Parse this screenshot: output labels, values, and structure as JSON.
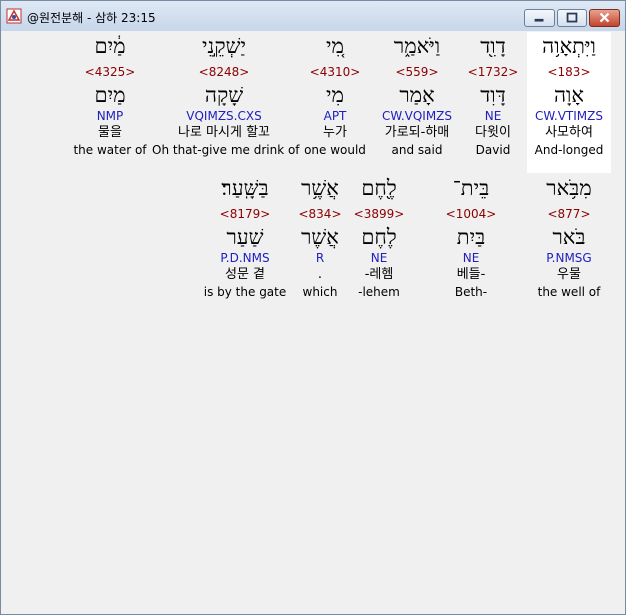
{
  "window": {
    "title": "@원전분해 - 삼하 23:15"
  },
  "rows": [
    {
      "words": [
        {
          "heb": "וַיִּתְאָו֥ה",
          "strong": "<183>",
          "lemma": "אָוָה",
          "parse": "CW.VTIMZS",
          "kor": "사모하여",
          "eng": "And-longed"
        },
        {
          "heb": "דָוִ֖ד",
          "strong": "<1732>",
          "lemma": "דָּוִד",
          "parse": "NE",
          "kor": "다윗이",
          "eng": "David"
        },
        {
          "heb": "וַיֹּאמַ֑ר",
          "strong": "<559>",
          "lemma": "אָמַר",
          "parse": "CW.VQIMZS",
          "kor": "가로되-하매",
          "eng": "and said"
        },
        {
          "heb": "מִ֚י",
          "strong": "<4310>",
          "lemma": "מִי",
          "parse": "APT",
          "kor": "누가",
          "eng": "one would"
        },
        {
          "heb": "יַשְׁקֵ֣נִי",
          "strong": "<8248>",
          "lemma": "שָׁקָה",
          "parse": "VQIMZS.CXS",
          "kor": "나로 마시게 할꼬",
          "eng": "Oh that-give me drink of"
        },
        {
          "heb": "מַ֔יִם",
          "strong": "<4325>",
          "lemma": "מַיִם",
          "parse": "NMP",
          "kor": "물을",
          "eng": "the water of"
        }
      ]
    },
    {
      "words": [
        {
          "heb": "מִבֹּ֥אר",
          "strong": "<877>",
          "lemma": "בֹּאר",
          "parse": "P.NMSG",
          "kor": "우물",
          "eng": "the well of"
        },
        {
          "heb": "בֵּית־",
          "strong": "<1004>",
          "lemma": "בַּיִת",
          "parse": "NE",
          "kor": "베들-",
          "eng": "Beth-"
        },
        {
          "heb": "לֶ֖חֶם",
          "strong": "<3899>",
          "lemma": "לֶחֶם",
          "parse": "NE",
          "kor": "-레헴",
          "eng": "-lehem"
        },
        {
          "heb": "אֲשֶׁ֥ר",
          "strong": "<834>",
          "lemma": "אֲשֶׁר",
          "parse": "R",
          "kor": ".",
          "eng": "which"
        },
        {
          "heb": "בַּשָּֽׁעַר׃",
          "strong": "<8179>",
          "lemma": "שַׁעַר",
          "parse": "P.D.NMS",
          "kor": "성문 곁",
          "eng": "is by the gate"
        }
      ]
    }
  ]
}
